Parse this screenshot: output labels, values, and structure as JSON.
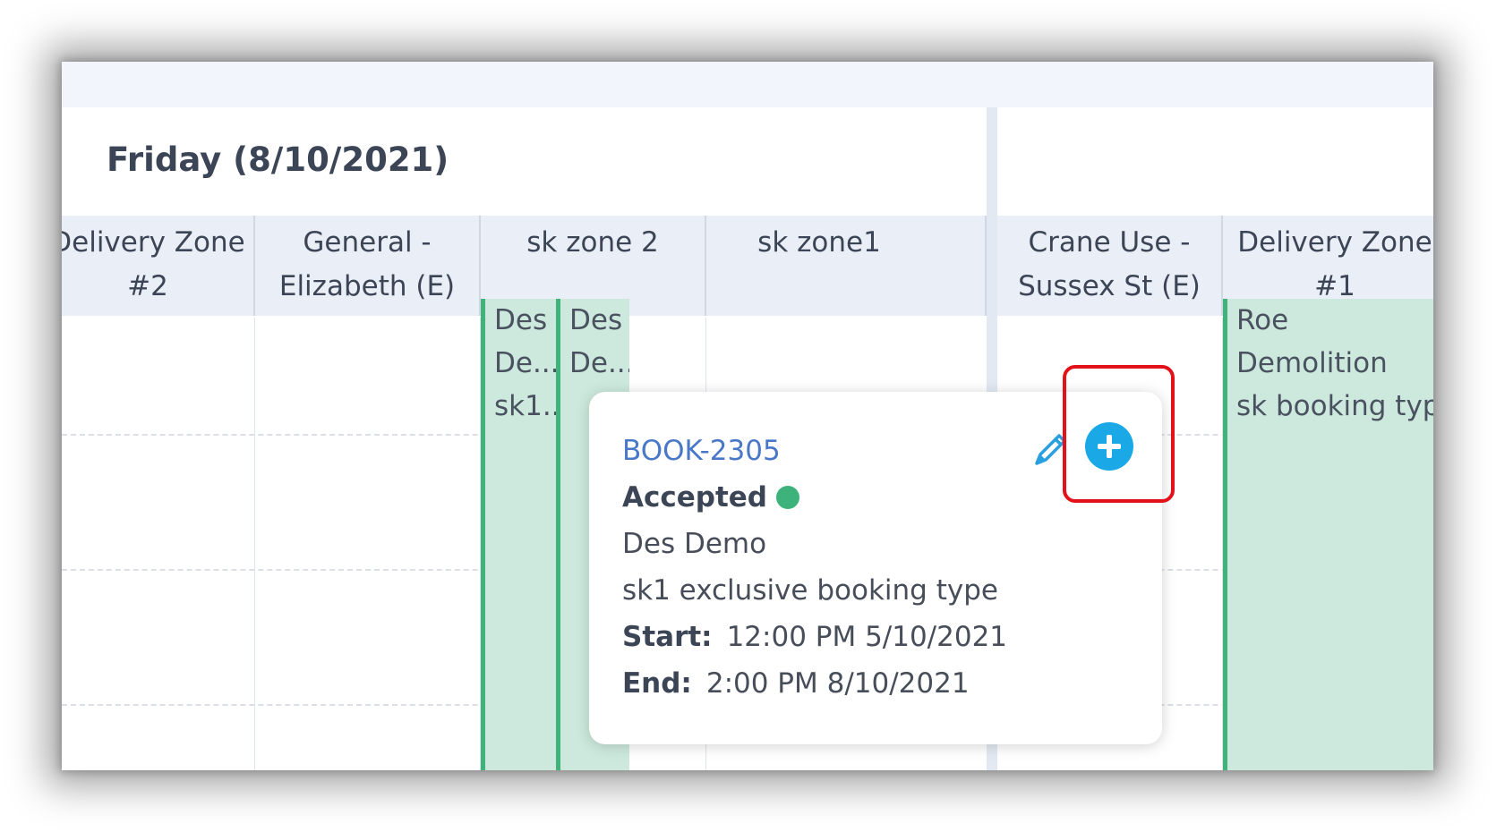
{
  "day_title": "Friday (8/10/2021)",
  "columns": [
    {
      "line1": "Delivery Zone",
      "line2": "#2"
    },
    {
      "line1": "General -",
      "line2": "Elizabeth (E)"
    },
    {
      "line1": "sk zone 2",
      "line2": ""
    },
    {
      "line1": "sk zone1",
      "line2": ""
    },
    {
      "line1": "Crane Use -",
      "line2": "Sussex St (E)"
    },
    {
      "line1": "Delivery Zone",
      "line2": "#1"
    }
  ],
  "events": [
    {
      "line1": "Des",
      "line2": "De...",
      "line3": "sk1..."
    },
    {
      "line1": "Des",
      "line2": "De...",
      "line3": ""
    },
    {
      "line1": "Roe",
      "line2": "Demolition",
      "line3": "sk booking type"
    }
  ],
  "popup": {
    "booking_id": "BOOK-2305",
    "status": "Accepted",
    "status_color": "#3db27b",
    "client": "Des Demo",
    "booking_type": "sk1 exclusive booking type",
    "start_label": "Start:",
    "start_value": "12:00 PM 5/10/2021",
    "end_label": "End:",
    "end_value": "2:00 PM 8/10/2021",
    "edit_icon": "pencil-icon",
    "add_icon": "plus-circle-icon"
  },
  "colors": {
    "accent": "#1aa9e6",
    "event_fill": "#cde9dd",
    "event_border": "#3fb37a",
    "highlight": "#e3121a"
  }
}
